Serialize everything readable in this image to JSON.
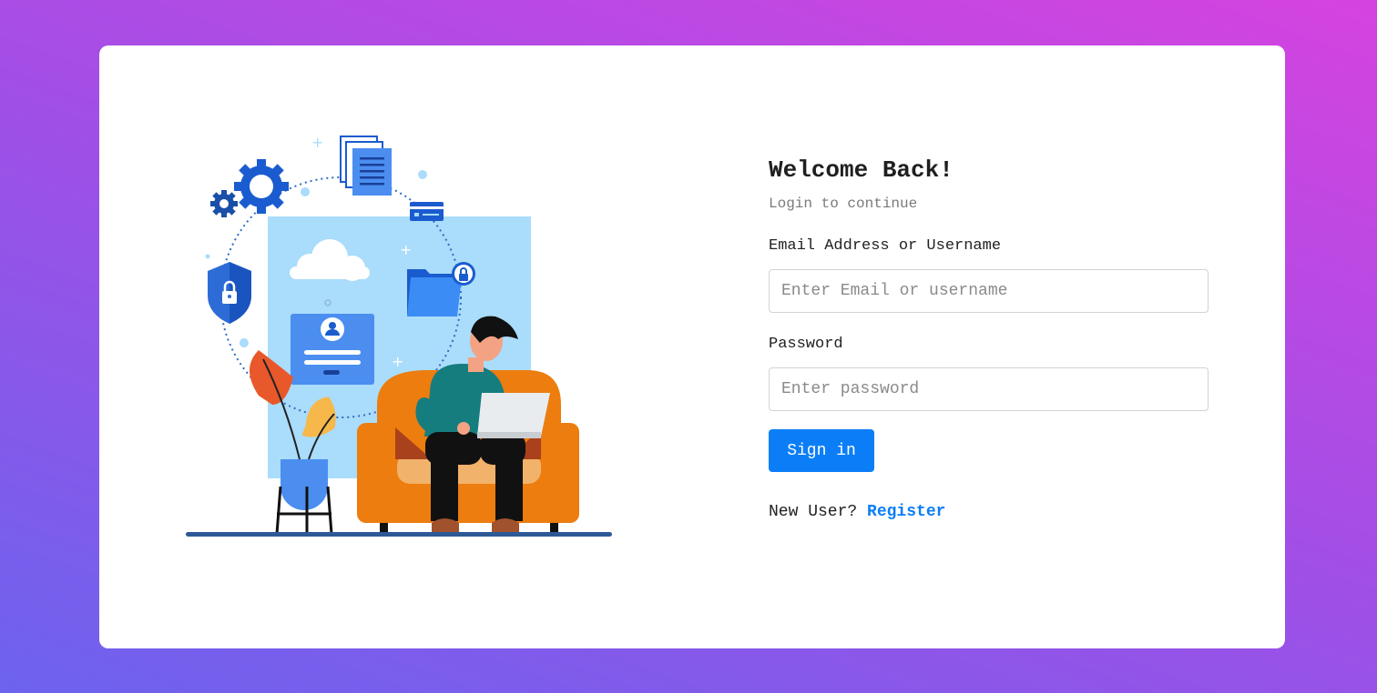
{
  "login": {
    "title": "Welcome Back!",
    "subtitle": "Login to continue",
    "email_label": "Email Address or Username",
    "email_placeholder": "Enter Email or username",
    "password_label": "Password",
    "password_placeholder": "Enter password",
    "submit_label": "Sign in",
    "new_user_text": "New User?",
    "register_label": "Register"
  },
  "illustration": {
    "subject": "person on armchair with laptop, surrounded by security icons",
    "icons": [
      "gear-icon",
      "documents-icon",
      "card-icon",
      "shield-lock-icon",
      "cloud-icon",
      "folder-lock-icon",
      "login-form-icon",
      "plant-icon"
    ]
  },
  "colors": {
    "accent": "#0b7ef7",
    "gradient_start": "#6c63ee",
    "gradient_end": "#d543e0"
  }
}
